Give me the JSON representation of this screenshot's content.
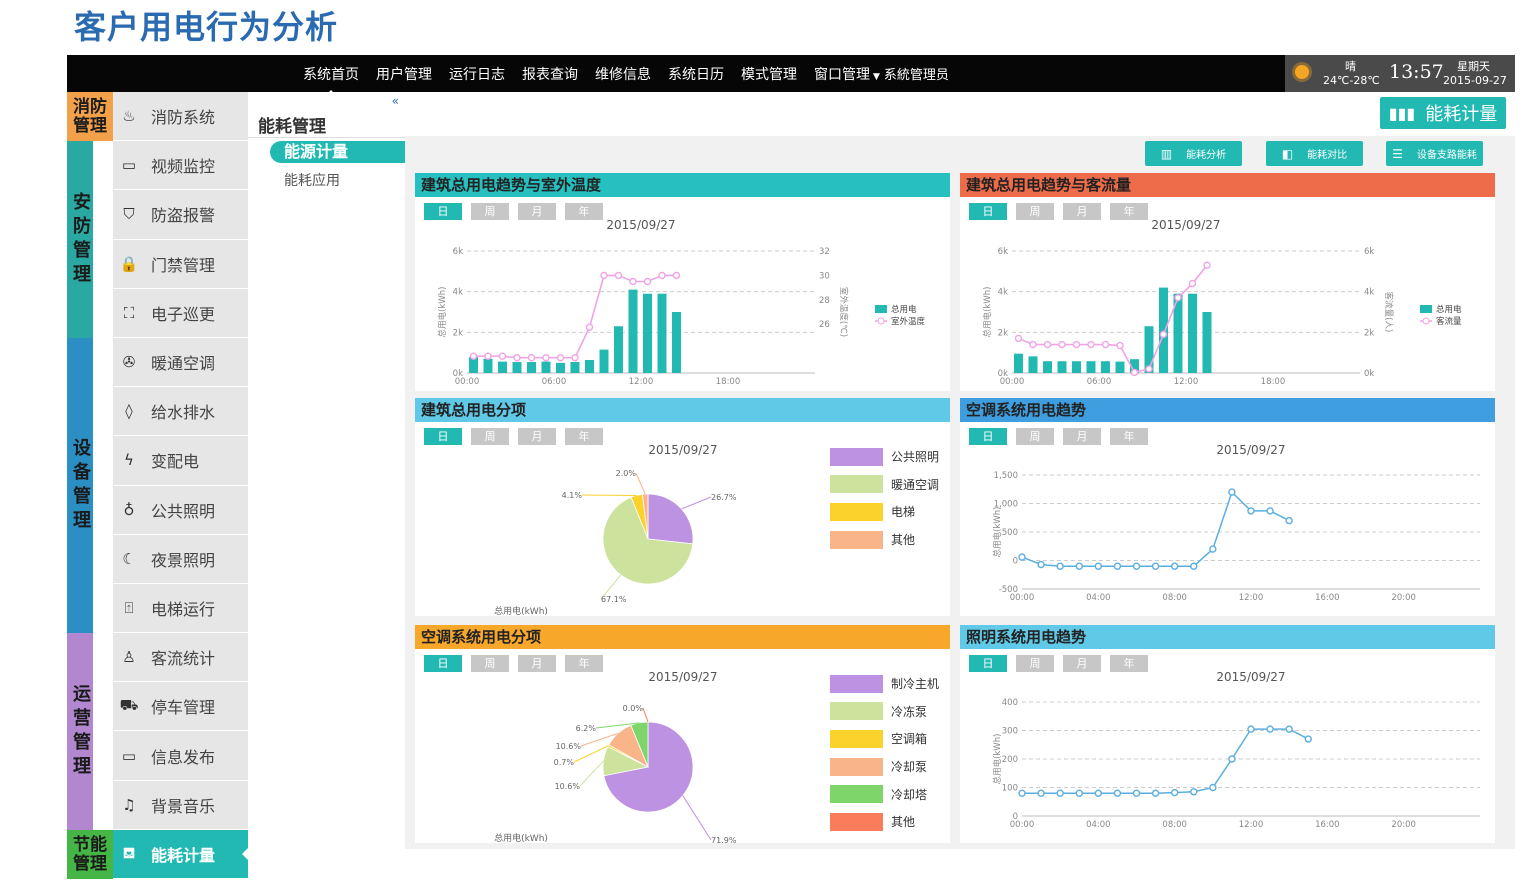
{
  "page_title": "客户用电行为分析",
  "nav": {
    "items": [
      "系统首页",
      "用户管理",
      "运行日志",
      "报表查询",
      "维修信息",
      "系统日历",
      "模式管理",
      "窗口管理"
    ],
    "user": "系統管理员"
  },
  "weather": {
    "condition": "晴",
    "temp": "24℃-28℃",
    "time": "13:57",
    "weekday": "星期天",
    "date": "2015-09-27"
  },
  "categories": [
    {
      "label": "消防管理",
      "color": "#f2a14a",
      "rows": 1
    },
    {
      "label": "安防管理",
      "color": "#2aa9a3",
      "rows": 4
    },
    {
      "label": "设备管理",
      "color": "#2b8fc4",
      "rows": 6
    },
    {
      "label": "运营管理",
      "color": "#b187cf",
      "rows": 4
    },
    {
      "label": "节能管理",
      "color": "#45b546",
      "rows": 1
    }
  ],
  "menu": [
    {
      "label": "消防系统",
      "icon": "fire-alarm-icon",
      "glyph": "♨"
    },
    {
      "label": "视频监控",
      "icon": "camera-icon",
      "glyph": "▭"
    },
    {
      "label": "防盗报警",
      "icon": "shield-icon",
      "glyph": "⛉"
    },
    {
      "label": "门禁管理",
      "icon": "lock-icon",
      "glyph": "🔒"
    },
    {
      "label": "电子巡更",
      "icon": "patrol-icon",
      "glyph": "⛶"
    },
    {
      "label": "暖通空调",
      "icon": "fan-icon",
      "glyph": "✇"
    },
    {
      "label": "给水排水",
      "icon": "water-drop-icon",
      "glyph": "◊"
    },
    {
      "label": "变配电",
      "icon": "lightning-icon",
      "glyph": "ϟ"
    },
    {
      "label": "公共照明",
      "icon": "bulb-icon",
      "glyph": "♁"
    },
    {
      "label": "夜景照明",
      "icon": "moon-icon",
      "glyph": "☾"
    },
    {
      "label": "电梯运行",
      "icon": "elevator-icon",
      "glyph": "⍐"
    },
    {
      "label": "客流统计",
      "icon": "people-icon",
      "glyph": "♙"
    },
    {
      "label": "停车管理",
      "icon": "car-icon",
      "glyph": "⛟"
    },
    {
      "label": "信息发布",
      "icon": "monitor-icon",
      "glyph": "▭"
    },
    {
      "label": "背景音乐",
      "icon": "music-icon",
      "glyph": "♫"
    },
    {
      "label": "能耗计量",
      "icon": "energy-meter-icon",
      "glyph": "⛾",
      "active": true
    }
  ],
  "subpanel": {
    "title": "能耗管理",
    "active": "能源计量",
    "item": "能耗应用",
    "collapse": "«"
  },
  "header_button": {
    "label": "能耗计量",
    "icon": "bar-chart-icon"
  },
  "tool_buttons": [
    {
      "label": "能耗分析",
      "icon": "analysis-icon"
    },
    {
      "label": "能耗对比",
      "icon": "compare-icon"
    },
    {
      "label": "设备支路能耗",
      "icon": "branch-icon"
    }
  ],
  "tabs": [
    "日",
    "周",
    "月",
    "年"
  ],
  "colors": {
    "teal": "#23b9b3",
    "pink": "#f0a3e6",
    "line_blue": "#5aaee0"
  },
  "panels": {
    "p1": {
      "title": "建筑总用电趋势与室外温度",
      "header_color": "#26c0c0"
    },
    "p2": {
      "title": "建筑总用电趋势与客流量",
      "header_color": "#ef6c4a"
    },
    "p3": {
      "title": "建筑总用电分项",
      "header_color": "#5fc9e7"
    },
    "p4": {
      "title": "空调系统用电趋势",
      "header_color": "#3f9ee0"
    },
    "p5": {
      "title": "空调系统用电分项",
      "header_color": "#f7a82b"
    },
    "p6": {
      "title": "照明系统用电趋势",
      "header_color": "#5fc9e7"
    }
  },
  "chart_data": [
    {
      "id": "p1",
      "type": "bar",
      "title": "2015/09/27",
      "x_ticks": [
        "00:00",
        "06:00",
        "12:00",
        "18:00"
      ],
      "xlabel": "",
      "ylabel": "总用电(kWh)",
      "y2label": "室外温度(℃)",
      "y_ticks": [
        "0k",
        "2k",
        "4k",
        "6k"
      ],
      "ylim": [
        0,
        6000
      ],
      "y2_ticks": [
        "26",
        "28",
        "30",
        "32"
      ],
      "y2lim": [
        24,
        32
      ],
      "series": [
        {
          "name": "总用电",
          "kind": "bar",
          "values": [
            780,
            700,
            560,
            540,
            540,
            560,
            500,
            540,
            640,
            1150,
            2300,
            4100,
            3900,
            3900,
            3000
          ]
        },
        {
          "name": "室外温度",
          "kind": "line",
          "axis": "y2",
          "values": [
            25.1,
            25.1,
            25.1,
            25.0,
            25.0,
            25.0,
            25.0,
            25.0,
            27.0,
            30.4,
            30.4,
            30.0,
            30.0,
            30.4,
            30.4
          ]
        }
      ],
      "legend": [
        "总用电",
        "室外温度"
      ]
    },
    {
      "id": "p2",
      "type": "bar",
      "title": "2015/09/27",
      "x_ticks": [
        "00:00",
        "06:00",
        "12:00",
        "18:00"
      ],
      "xlabel": "",
      "ylabel": "总用电(kWh)",
      "y2label": "客流量(人)",
      "y_ticks": [
        "0k",
        "2k",
        "4k",
        "6k"
      ],
      "ylim": [
        0,
        6000
      ],
      "y2_ticks": [
        "0k",
        "2k",
        "4k",
        "6k"
      ],
      "y2lim": [
        0,
        6000
      ],
      "series": [
        {
          "name": "总用电",
          "kind": "bar",
          "values": [
            950,
            820,
            580,
            580,
            580,
            580,
            580,
            560,
            680,
            2300,
            4200,
            3900,
            3900,
            3000
          ]
        },
        {
          "name": "客流量",
          "kind": "line",
          "axis": "y2",
          "values": [
            1700,
            1400,
            1400,
            1400,
            1400,
            1400,
            1400,
            1350,
            30,
            200,
            1900,
            3700,
            4400,
            5300
          ]
        }
      ],
      "legend": [
        "总用电",
        "客流量"
      ]
    },
    {
      "id": "p3",
      "type": "pie",
      "title": "2015/09/27",
      "caption": "总用电(kWh)",
      "slices": [
        {
          "name": "公共照明",
          "value": 26.7,
          "label": "26.7%",
          "color": "#bd92e2"
        },
        {
          "name": "暖通空调",
          "value": 67.1,
          "label": "67.1%",
          "color": "#cde39d"
        },
        {
          "name": "电梯",
          "value": 4.1,
          "label": "4.1%",
          "color": "#fad22b"
        },
        {
          "name": "其他",
          "value": 2.0,
          "label": "2.0%",
          "color": "#fab48a"
        }
      ]
    },
    {
      "id": "p4",
      "type": "line",
      "title": "2015/09/27",
      "x_ticks": [
        "00:00",
        "04:00",
        "08:00",
        "12:00",
        "16:00",
        "20:00"
      ],
      "xlabel": "",
      "ylabel": "总用电(kWh)",
      "y_ticks": [
        "-500",
        "0",
        "500",
        "1,000",
        "1,500"
      ],
      "ylim": [
        -500,
        1500
      ],
      "series": [
        {
          "name": "空调系统",
          "values": [
            60,
            -70,
            -100,
            -100,
            -100,
            -100,
            -100,
            -100,
            -100,
            -100,
            200,
            1200,
            870,
            870,
            700
          ]
        }
      ]
    },
    {
      "id": "p5",
      "type": "pie",
      "title": "2015/09/27",
      "caption": "总用电(kWh)",
      "slices": [
        {
          "name": "制冷主机",
          "value": 71.9,
          "label": "71.9%",
          "color": "#bd92e2"
        },
        {
          "name": "冷冻泵",
          "value": 10.6,
          "label": "10.6%",
          "color": "#cde39d"
        },
        {
          "name": "空调箱",
          "value": 0.7,
          "label": "0.7%",
          "color": "#fad22b"
        },
        {
          "name": "冷却泵",
          "value": 10.6,
          "label": "10.6%",
          "color": "#fab48a"
        },
        {
          "name": "冷却塔",
          "value": 6.2,
          "label": "6.2%",
          "color": "#7ed56a"
        },
        {
          "name": "其他",
          "value": 0.0,
          "label": "0.0%",
          "color": "#fb7c5a"
        }
      ]
    },
    {
      "id": "p6",
      "type": "line",
      "title": "2015/09/27",
      "x_ticks": [
        "00:00",
        "04:00",
        "08:00",
        "12:00",
        "16:00",
        "20:00"
      ],
      "xlabel": "",
      "ylabel": "总用电(kWh)",
      "y_ticks": [
        "0",
        "100",
        "200",
        "300",
        "400"
      ],
      "ylim": [
        0,
        400
      ],
      "series": [
        {
          "name": "照明系统",
          "values": [
            80,
            80,
            80,
            80,
            80,
            80,
            80,
            80,
            82,
            85,
            100,
            200,
            305,
            305,
            305,
            270
          ]
        }
      ]
    }
  ]
}
